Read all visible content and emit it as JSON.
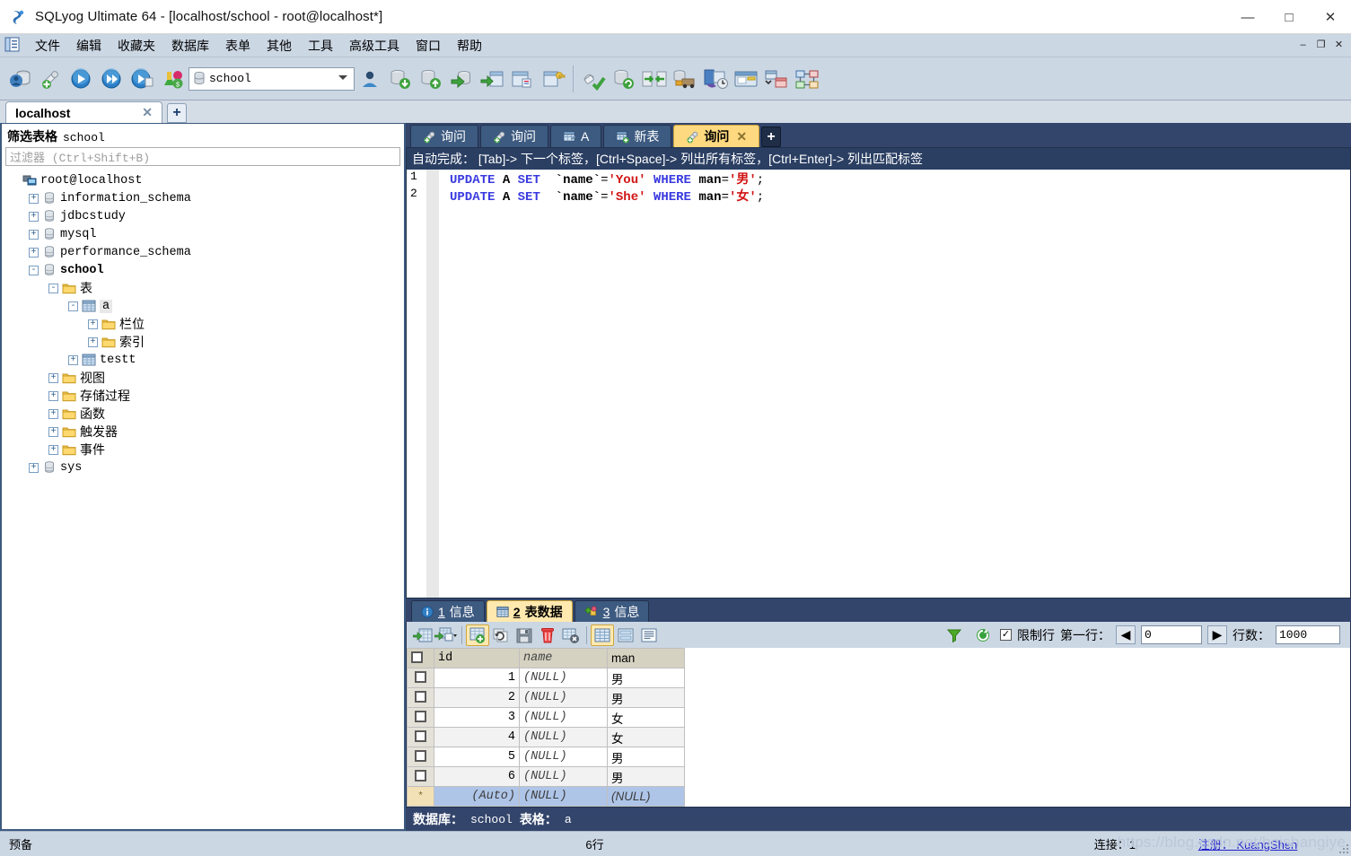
{
  "window": {
    "title": "SQLyog Ultimate 64 - [localhost/school - root@localhost*]",
    "icon": "sqlyog-logo-icon",
    "minimize": "—",
    "maximize": "□",
    "close": "✕"
  },
  "menubar": {
    "items": [
      {
        "label": "文件",
        "name": "menu-file"
      },
      {
        "label": "编辑",
        "name": "menu-edit"
      },
      {
        "label": "收藏夹",
        "name": "menu-favorites"
      },
      {
        "label": "数据库",
        "name": "menu-database"
      },
      {
        "label": "表单",
        "name": "menu-table"
      },
      {
        "label": "其他",
        "name": "menu-others"
      },
      {
        "label": "工具",
        "name": "menu-tools"
      },
      {
        "label": "高级工具",
        "name": "menu-powertools"
      },
      {
        "label": "窗口",
        "name": "menu-window"
      },
      {
        "label": "帮助",
        "name": "menu-help"
      }
    ],
    "mdi_buttons": [
      "–",
      "❐",
      "✕"
    ]
  },
  "toolbar": {
    "buttons": [
      "new-connection-icon",
      "new-query-tab-icon",
      "execute-query-icon",
      "execute-all-queries-icon",
      "execute-current-query-icon",
      "stop-execute-icon"
    ],
    "db_selector": {
      "value": "school",
      "icon": "database-icon"
    },
    "buttons_right": [
      "user-manager-icon",
      "backup-database-icon",
      "restore-database-icon",
      "export-database-icon",
      "export-table-icon",
      "table-diagnostics-icon",
      "schema-designer-icon"
    ],
    "buttons_far_right": [
      "flush-icon",
      "sync-database-icon",
      "schema-sync-icon",
      "migration-icon",
      "scheduled-backup-icon",
      "notification-icon",
      "table-data-compare-icon",
      "query-builder-icon"
    ]
  },
  "connection_tabs": {
    "tabs": [
      {
        "label": "localhost",
        "close": "✕"
      }
    ],
    "add_label": "+"
  },
  "sidebar": {
    "filter_title_label": "筛选表格",
    "filter_db": "school",
    "filter_placeholder": "过滤器 (Ctrl+Shift+B)",
    "tree": [
      {
        "label": "root@localhost",
        "icon": "host-icon",
        "indent": 0,
        "toggle": "",
        "bold": false,
        "mono": true
      },
      {
        "label": "information_schema",
        "icon": "db-icon",
        "indent": 1,
        "toggle": "+",
        "bold": false,
        "mono": true
      },
      {
        "label": "jdbcstudy",
        "icon": "db-icon",
        "indent": 1,
        "toggle": "+",
        "bold": false,
        "mono": true
      },
      {
        "label": "mysql",
        "icon": "db-icon",
        "indent": 1,
        "toggle": "+",
        "bold": false,
        "mono": true
      },
      {
        "label": "performance_schema",
        "icon": "db-icon",
        "indent": 1,
        "toggle": "+",
        "bold": false,
        "mono": true
      },
      {
        "label": "school",
        "icon": "db-icon",
        "indent": 1,
        "toggle": "-",
        "bold": true,
        "mono": true
      },
      {
        "label": "表",
        "icon": "folder-icon",
        "indent": 2,
        "toggle": "-",
        "bold": false,
        "mono": false
      },
      {
        "label": "a",
        "icon": "table-icon",
        "indent": 3,
        "toggle": "-",
        "bold": false,
        "mono": true,
        "selected": true
      },
      {
        "label": "栏位",
        "icon": "folder-icon",
        "indent": 4,
        "toggle": "+",
        "bold": false,
        "mono": false
      },
      {
        "label": "索引",
        "icon": "folder-icon",
        "indent": 4,
        "toggle": "+",
        "bold": false,
        "mono": false
      },
      {
        "label": "testt",
        "icon": "table-icon",
        "indent": 3,
        "toggle": "+",
        "bold": false,
        "mono": true
      },
      {
        "label": "视图",
        "icon": "folder-icon",
        "indent": 2,
        "toggle": "+",
        "bold": false,
        "mono": false
      },
      {
        "label": "存储过程",
        "icon": "folder-icon",
        "indent": 2,
        "toggle": "+",
        "bold": false,
        "mono": false
      },
      {
        "label": "函数",
        "icon": "folder-icon",
        "indent": 2,
        "toggle": "+",
        "bold": false,
        "mono": false
      },
      {
        "label": "触发器",
        "icon": "folder-icon",
        "indent": 2,
        "toggle": "+",
        "bold": false,
        "mono": false
      },
      {
        "label": "事件",
        "icon": "folder-icon",
        "indent": 2,
        "toggle": "+",
        "bold": false,
        "mono": false
      },
      {
        "label": "sys",
        "icon": "db-icon",
        "indent": 1,
        "toggle": "+",
        "bold": false,
        "mono": true
      }
    ]
  },
  "query_tabs": {
    "tabs": [
      {
        "label": "询问",
        "icon": "query-icon",
        "active": false,
        "closable": false
      },
      {
        "label": "询问",
        "icon": "query-icon",
        "active": false,
        "closable": false
      },
      {
        "label": "A",
        "icon": "table-data-icon",
        "active": false,
        "closable": false
      },
      {
        "label": "新表",
        "icon": "new-table-icon",
        "active": false,
        "closable": false
      },
      {
        "label": "询问",
        "icon": "query-icon",
        "active": true,
        "closable": true,
        "close": "✕"
      }
    ],
    "add_label": "+"
  },
  "editor": {
    "autocomplete_hint": "自动完成： [Tab]-> 下一个标签，[Ctrl+Space]-> 列出所有标签，[Ctrl+Enter]-> 列出匹配标签",
    "lines": [
      {
        "no": "1",
        "tokens": [
          {
            "t": "UPDATE",
            "c": "kw"
          },
          {
            "t": " ",
            "c": "punc"
          },
          {
            "t": "A",
            "c": "id"
          },
          {
            "t": " ",
            "c": "punc"
          },
          {
            "t": "SET",
            "c": "kw"
          },
          {
            "t": "  ",
            "c": "punc"
          },
          {
            "t": "`name`",
            "c": "id"
          },
          {
            "t": "=",
            "c": "punc"
          },
          {
            "t": "'You'",
            "c": "str"
          },
          {
            "t": " ",
            "c": "punc"
          },
          {
            "t": "WHERE",
            "c": "kw"
          },
          {
            "t": " ",
            "c": "punc"
          },
          {
            "t": "man",
            "c": "id"
          },
          {
            "t": "=",
            "c": "punc"
          },
          {
            "t": "'男'",
            "c": "str"
          },
          {
            "t": ";",
            "c": "punc"
          }
        ]
      },
      {
        "no": "2",
        "tokens": [
          {
            "t": "UPDATE",
            "c": "kw"
          },
          {
            "t": " ",
            "c": "punc"
          },
          {
            "t": "A",
            "c": "id"
          },
          {
            "t": " ",
            "c": "punc"
          },
          {
            "t": "SET",
            "c": "kw"
          },
          {
            "t": "  ",
            "c": "punc"
          },
          {
            "t": "`name`",
            "c": "id"
          },
          {
            "t": "=",
            "c": "punc"
          },
          {
            "t": "'She'",
            "c": "str"
          },
          {
            "t": " ",
            "c": "punc"
          },
          {
            "t": "WHERE",
            "c": "kw"
          },
          {
            "t": " ",
            "c": "punc"
          },
          {
            "t": "man",
            "c": "id"
          },
          {
            "t": "=",
            "c": "punc"
          },
          {
            "t": "'女'",
            "c": "str"
          },
          {
            "t": ";",
            "c": "punc"
          }
        ]
      }
    ]
  },
  "result_tabs": {
    "tabs": [
      {
        "num": "1",
        "label": "信息",
        "icon": "info-icon",
        "active": false
      },
      {
        "num": "2",
        "label": "表数据",
        "icon": "grid-icon",
        "active": true
      },
      {
        "num": "3",
        "label": "信息",
        "icon": "objects-icon",
        "active": false
      }
    ]
  },
  "grid_toolbar": {
    "left_buttons": [
      "insert-row-icon",
      "insert-row-dropdown-icon",
      "new-record-icon",
      "refresh-data-icon",
      "save-changes-icon",
      "delete-row-icon",
      "cancel-changes-icon"
    ],
    "view_buttons": [
      "grid-view-icon",
      "form-view-icon",
      "text-view-icon"
    ],
    "filter_icon": "filter-icon",
    "refresh_icon": "refresh-icon",
    "limit_checkbox_label": "限制行",
    "limit_checked": true,
    "first_row_label": "第一行：",
    "first_row_value": "0",
    "row_count_label": "行数：",
    "row_count_value": "1000",
    "prev_icon": "◀",
    "next_icon": "▶"
  },
  "grid": {
    "columns": [
      "id",
      "name",
      "man"
    ],
    "rows": [
      {
        "id": "1",
        "name": "(NULL)",
        "man": "男"
      },
      {
        "id": "2",
        "name": "(NULL)",
        "man": "男"
      },
      {
        "id": "3",
        "name": "(NULL)",
        "man": "女"
      },
      {
        "id": "4",
        "name": "(NULL)",
        "man": "女"
      },
      {
        "id": "5",
        "name": "(NULL)",
        "man": "男"
      },
      {
        "id": "6",
        "name": "(NULL)",
        "man": "男"
      }
    ],
    "new_row": {
      "marker": "*",
      "id": "(Auto)",
      "name": "(NULL)",
      "man": "(NULL)"
    }
  },
  "db_status": {
    "db_label": "数据库：",
    "db_value": "school",
    "table_label": "表格：",
    "table_value": "a"
  },
  "statusbar": {
    "state": "预备",
    "rows": "6行",
    "connections_label": "连接：",
    "connections_value": "1",
    "register_link": "注册： KuangShen",
    "watermark": "https://blog.csdn.net/beishangiye"
  },
  "colors": {
    "accent_blue": "#33456b",
    "tab_active": "#ffd97f",
    "toolbar_bg": "#ccd7e4",
    "sql_keyword": "#3a3ae0",
    "sql_string": "#d11414",
    "grid_header": "#d6d2c2",
    "new_row": "#aec5e8"
  }
}
